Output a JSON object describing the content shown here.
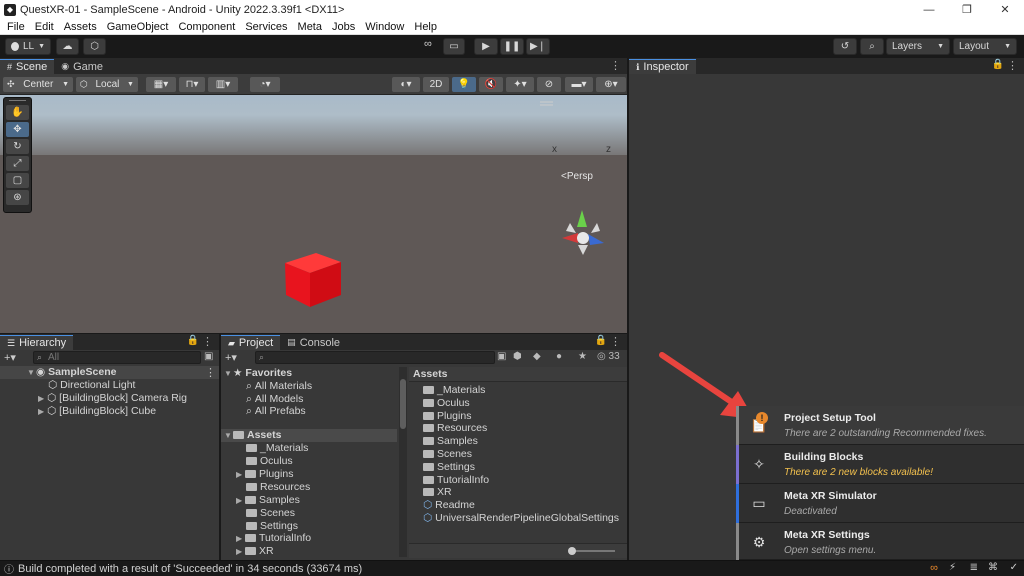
{
  "window": {
    "title": "QuestXR-01 - SampleScene - Android - Unity 2022.3.39f1 <DX11>",
    "minimize": "—",
    "restore": "❐",
    "close": "✕"
  },
  "menu": [
    "File",
    "Edit",
    "Assets",
    "GameObject",
    "Component",
    "Services",
    "Meta",
    "Jobs",
    "Window",
    "Help"
  ],
  "toolbar": {
    "account": "LL",
    "layers": "Layers",
    "layout": "Layout"
  },
  "scene_tabs": [
    "Scene",
    "Game"
  ],
  "scene_toolbar": {
    "pivot": "Center",
    "space": "Local",
    "mode_2d": "2D"
  },
  "scene_view": {
    "persp_label": "<Persp",
    "axis_x": "x",
    "axis_z": "z"
  },
  "hierarchy": {
    "tab": "Hierarchy",
    "search_placeholder": "All",
    "scene": "SampleScene",
    "items": [
      "Directional Light",
      "[BuildingBlock] Camera Rig",
      "[BuildingBlock] Cube"
    ]
  },
  "project": {
    "tabs": [
      "Project",
      "Console"
    ],
    "hidden_count": "33",
    "favorites_label": "Favorites",
    "favorites": [
      "All Materials",
      "All Models",
      "All Prefabs"
    ],
    "assets_label": "Assets",
    "tree": [
      "_Materials",
      "Oculus",
      "Plugins",
      "Resources",
      "Samples",
      "Scenes",
      "Settings",
      "TutorialInfo",
      "XR"
    ],
    "grid_header": "Assets",
    "grid_items": [
      "_Materials",
      "Oculus",
      "Plugins",
      "Resources",
      "Samples",
      "Scenes",
      "Settings",
      "TutorialInfo",
      "XR",
      "Readme",
      "UniversalRenderPipelineGlobalSettings"
    ]
  },
  "inspector": {
    "tab": "Inspector"
  },
  "meta_panel": [
    {
      "title": "Project Setup Tool",
      "subtitle": "There are 2 outstanding Recommended fixes.",
      "accent": "#8a8a8a",
      "subcolor": "#aaaaaa",
      "icon": "clipboard-check-icon"
    },
    {
      "title": "Building Blocks",
      "subtitle": "There are 2 new blocks available!",
      "accent": "#7b6fd0",
      "subcolor": "#f3c14e",
      "icon": "blocks-sparkle-icon"
    },
    {
      "title": "Meta XR Simulator",
      "subtitle": "Deactivated",
      "accent": "#2f6fdc",
      "subcolor": "#aaaaaa",
      "icon": "monitor-icon"
    },
    {
      "title": "Meta XR Settings",
      "subtitle": "Open settings menu.",
      "accent": "#8a8a8a",
      "subcolor": "#aaaaaa",
      "icon": "gear-icon"
    }
  ],
  "status": {
    "message": "Build completed with a result of 'Succeeded' in 34 seconds (33674 ms)"
  },
  "colors": {
    "cube": "#e8141e",
    "arrow": "#e8443e",
    "warning_badge": "#e8882c"
  }
}
